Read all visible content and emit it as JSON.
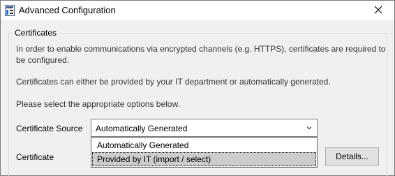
{
  "window": {
    "title": "Advanced Configuration"
  },
  "group": {
    "legend": "Certificates",
    "paragraph1": "In order to enable communications via encrypted channels (e.g. HTTPS), certificates are required to be configured.",
    "paragraph2": "Certificates can either be provided by your IT department or automatically generated.",
    "paragraph3": "Please select the appropriate options below."
  },
  "form": {
    "certificate_source_label": "Certificate Source",
    "certificate_label": "Certificate",
    "certificate_source_value": "Automatically Generated",
    "options": [
      "Automatically Generated",
      "Provided by IT (import / select)"
    ],
    "details_button": "Details..."
  },
  "icons": {
    "app": "app-icon",
    "close": "close-icon",
    "dropdown": "chevron-down-icon"
  }
}
